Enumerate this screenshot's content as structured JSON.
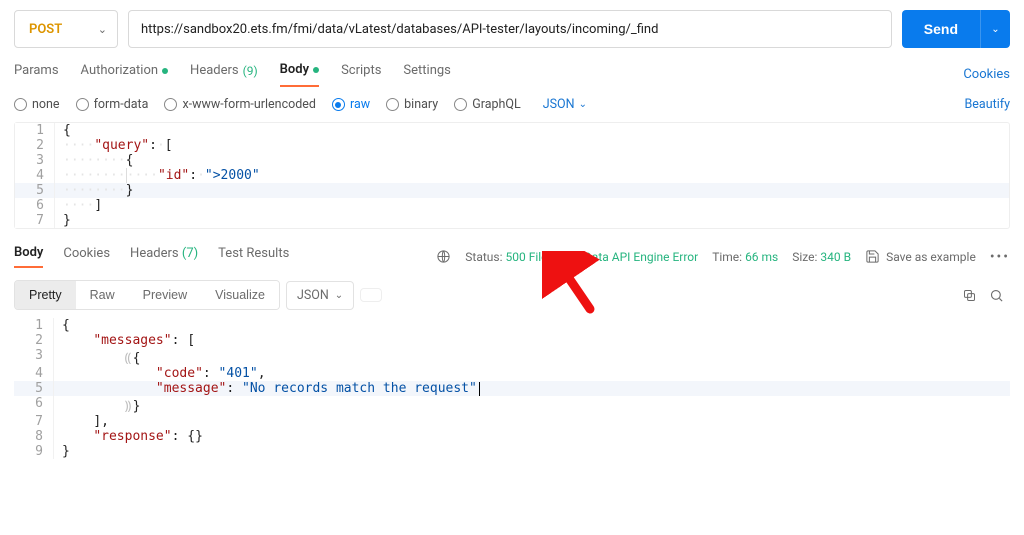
{
  "method": {
    "label": "POST",
    "color": "#dd9500"
  },
  "url": "https://sandbox20.ets.fm/fmi/data/vLatest/databases/API-tester/layouts/incoming/_find",
  "sendLabel": "Send",
  "reqTabs": {
    "params": "Params",
    "auth": "Authorization",
    "headers": "Headers",
    "headersCount": "(9)",
    "body": "Body",
    "scripts": "Scripts",
    "settings": "Settings",
    "cookies": "Cookies"
  },
  "bodyTypes": {
    "none": "none",
    "formdata": "form-data",
    "xwww": "x-www-form-urlencoded",
    "raw": "raw",
    "binary": "binary",
    "graphql": "GraphQL",
    "langSel": "JSON",
    "beautify": "Beautify"
  },
  "requestBody": {
    "lines": [
      {
        "n": "1",
        "raw": "{"
      },
      {
        "n": "2",
        "raw": "····\"query\":·[",
        "k": "query"
      },
      {
        "n": "3",
        "raw": "········{"
      },
      {
        "n": "4",
        "raw": "············\"id\":·\">2000\"",
        "k": "id",
        "v": ">2000"
      },
      {
        "n": "5",
        "raw": "········}"
      },
      {
        "n": "6",
        "raw": "····]"
      },
      {
        "n": "7",
        "raw": "}"
      }
    ]
  },
  "respTabs": {
    "body": "Body",
    "cookies": "Cookies",
    "headers": "Headers",
    "headersCount": "(7)",
    "testResults": "Test Results"
  },
  "respMeta": {
    "statusLabel": "Status:",
    "statusValue": "500 FileMaker Data API Engine Error",
    "timeLabel": "Time:",
    "timeValue": "66 ms",
    "sizeLabel": "Size:",
    "sizeValue": "340 B",
    "saveExample": "Save as example"
  },
  "respView": {
    "pretty": "Pretty",
    "raw": "Raw",
    "preview": "Preview",
    "visualize": "Visualize",
    "langSel": "JSON"
  },
  "responseBody": {
    "lines": [
      {
        "n": "1",
        "t": "{"
      },
      {
        "n": "2",
        "k": "messages",
        "after": ": ["
      },
      {
        "n": "3",
        "t": "{"
      },
      {
        "n": "4",
        "k": "code",
        "v": "401",
        "comma": true
      },
      {
        "n": "5",
        "k": "message",
        "v": "No records match the request"
      },
      {
        "n": "6",
        "t": "}"
      },
      {
        "n": "7",
        "t": "],"
      },
      {
        "n": "8",
        "k": "response",
        "after": ": {}"
      },
      {
        "n": "9",
        "t": "}"
      }
    ]
  }
}
